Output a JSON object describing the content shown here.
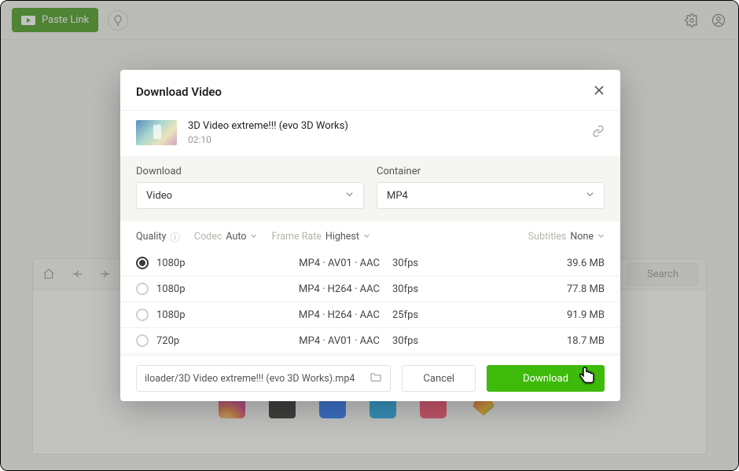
{
  "topbar": {
    "paste_label": "Paste Link"
  },
  "browser": {
    "search_label": "Search"
  },
  "modal": {
    "title": "Download Video",
    "video": {
      "title": "3D Video extreme!!! (evo 3D Works)",
      "duration": "02:10"
    },
    "download_label": "Download",
    "container_label": "Container",
    "download_type": "Video",
    "container_type": "MP4",
    "filters": {
      "quality_label": "Quality",
      "codec_label": "Codec",
      "codec_value": "Auto",
      "framerate_label": "Frame Rate",
      "framerate_value": "Highest",
      "subtitles_label": "Subtitles",
      "subtitles_value": "None"
    },
    "options": [
      {
        "res": "1080p",
        "enc": "MP4 · AV01 · AAC",
        "fps": "30fps",
        "size": "39.6 MB",
        "selected": true
      },
      {
        "res": "1080p",
        "enc": "MP4 · H264 · AAC",
        "fps": "30fps",
        "size": "77.8 MB",
        "selected": false
      },
      {
        "res": "1080p",
        "enc": "MP4 · H264 · AAC",
        "fps": "25fps",
        "size": "91.9 MB",
        "selected": false
      },
      {
        "res": "720p",
        "enc": "MP4 · AV01 · AAC",
        "fps": "30fps",
        "size": "18.7 MB",
        "selected": false
      }
    ],
    "save_path": "iloader/3D Video extreme!!! (evo 3D Works).mp4",
    "cancel_label": "Cancel",
    "confirm_label": "Download"
  },
  "colors": {
    "accent": "#3eba0a"
  }
}
